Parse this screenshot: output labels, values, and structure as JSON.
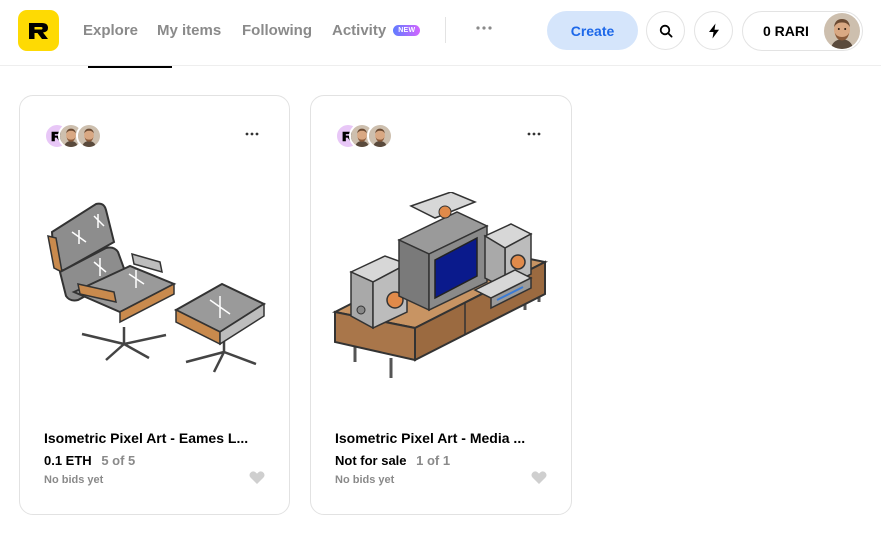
{
  "header": {
    "logo_letter": "R",
    "nav": {
      "explore": "Explore",
      "my_items": "My items",
      "following": "Following",
      "activity": "Activity",
      "activity_badge": "NEW"
    },
    "create_label": "Create",
    "wallet_balance": "0 RARI"
  },
  "colors": {
    "logo_bg": "#feda03",
    "create_bg": "#d5e5fb",
    "create_text": "#1d68e9",
    "muted_text": "#8a8a8a"
  },
  "icons": {
    "more": "more-horizontal-icon",
    "search": "search-icon",
    "bolt": "bolt-icon",
    "like": "heart-icon"
  },
  "cards": [
    {
      "title": "Isometric Pixel Art - Eames L...",
      "price": "0.1 ETH",
      "stock": "5 of 5",
      "bids": "No bids yet",
      "art": "eames-lounge-chair-pixel-art"
    },
    {
      "title": "Isometric Pixel Art - Media ...",
      "price": "Not for sale",
      "stock": "1 of 1",
      "bids": "No bids yet",
      "art": "media-console-pixel-art"
    }
  ]
}
